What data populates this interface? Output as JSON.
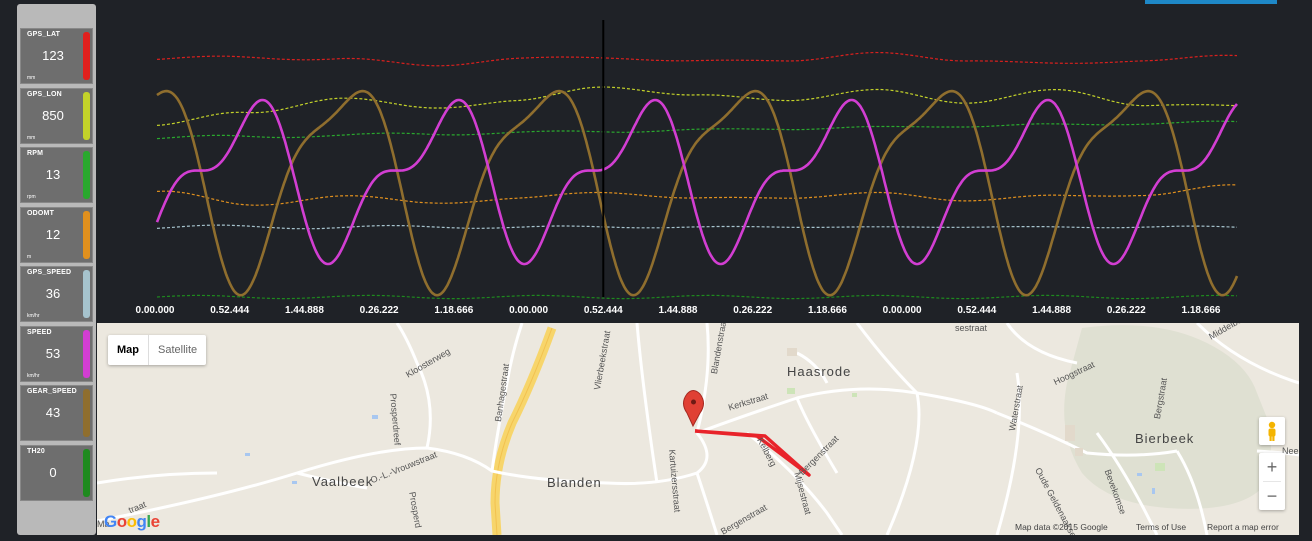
{
  "sensors": [
    {
      "name": "GPS_LAT",
      "value": "123",
      "unit": "mm",
      "color": "#e0201e"
    },
    {
      "name": "GPS_LON",
      "value": "850",
      "unit": "mm",
      "color": "#c3d22a"
    },
    {
      "name": "RPM",
      "value": "13",
      "unit": "rpm",
      "color": "#2aa82e"
    },
    {
      "name": "ODOMT",
      "value": "12",
      "unit": "m",
      "color": "#e0901e"
    },
    {
      "name": "GPS_SPEED",
      "value": "36",
      "unit": "km/hr",
      "color": "#a6c3cd"
    },
    {
      "name": "SPEED",
      "value": "53",
      "unit": "km/hr",
      "color": "#d23ed2"
    },
    {
      "name": "GEAR_SPEED",
      "value": "43",
      "unit": "",
      "color": "#8f6e2e"
    },
    {
      "name": "TH20",
      "value": "0",
      "unit": "",
      "color": "#1e8a1e"
    }
  ],
  "chart_data": {
    "type": "line",
    "x_tick_labels": [
      "0.00.000",
      "0.52.444",
      "1.44.888",
      "0.26.222",
      "1.18.666",
      "0.00.000",
      "0.52.444",
      "1.44.888",
      "0.26.222",
      "1.18.666",
      "0.00.000",
      "0.52.444",
      "1.44.888",
      "0.26.222",
      "1.18.666"
    ],
    "series": [
      {
        "name": "GPS_LAT",
        "color": "#d8201e",
        "style": "dashed",
        "values": [
          0.9,
          0.91,
          0.9,
          0.88,
          0.9,
          0.91,
          0.89,
          0.9,
          0.92,
          0.9,
          0.88,
          0.9,
          0.91
        ]
      },
      {
        "name": "GPS_LON",
        "color": "#c3d22a",
        "style": "dashed",
        "values": [
          0.65,
          0.7,
          0.75,
          0.72,
          0.74,
          0.8,
          0.76,
          0.75,
          0.78,
          0.74,
          0.78,
          0.73,
          0.72
        ]
      },
      {
        "name": "RPM",
        "color": "#2aa82e",
        "style": "dashed",
        "values": [
          0.6,
          0.61,
          0.61,
          0.62,
          0.62,
          0.63,
          0.63,
          0.64,
          0.64,
          0.65,
          0.65,
          0.66,
          0.66
        ]
      },
      {
        "name": "ODOMT",
        "color": "#e0901e",
        "style": "dashed",
        "values": [
          0.4,
          0.35,
          0.38,
          0.36,
          0.37,
          0.4,
          0.37,
          0.38,
          0.39,
          0.37,
          0.38,
          0.39,
          0.42
        ]
      },
      {
        "name": "GPS_SPEED",
        "color": "#a6c3cd",
        "style": "dashed",
        "values": [
          0.26,
          0.27,
          0.26,
          0.27,
          0.26,
          0.27,
          0.26,
          0.27,
          0.26,
          0.27,
          0.26,
          0.27,
          0.26
        ]
      },
      {
        "name": "TH20",
        "color": "#1e8a1e",
        "style": "dashed",
        "values": [
          0.0,
          0.0,
          0.0,
          0.0,
          0.0,
          0.0,
          0.0,
          0.0,
          0.0,
          0.0,
          0.0,
          0.0,
          0.0
        ]
      },
      {
        "name": "GEAR_SPEED",
        "color": "#8f6e2e",
        "style": "solid",
        "cycles": 5.5,
        "phase": 0.2
      },
      {
        "name": "SPEED",
        "color": "#d23ed2",
        "style": "solid",
        "cycles": 5.5,
        "phase": 0.0
      }
    ],
    "cursor_tick_index": 6,
    "grid": false
  },
  "map": {
    "map_type_labels": {
      "map": "Map",
      "satellite": "Satellite"
    },
    "places": {
      "haasrode": "Haasrode",
      "vaalbeek": "Vaalbeek",
      "blanden": "Blanden",
      "bierbeek": "Bierbeek"
    },
    "streets": [
      "Kloosterweg",
      "Prosperdreef",
      "Banhagestraat",
      "Vlierbeekstraat",
      "Blandenstraat",
      "Kerkstraat",
      "Kartuizersstraat",
      "Kelberg",
      "Bergenstraat",
      "Bergenstraat",
      "Mijsestraat",
      "O.-L.-Vrouwstraat",
      "Prosperd",
      "Hoogstraat",
      "Waterstraat",
      "Bergstraat",
      "Oude Geldenaakse",
      "Bevekomse",
      "Middelbosstraat",
      "sestraat",
      "traat",
      "Nee",
      "Ma"
    ],
    "zoom_in": "+",
    "zoom_out": "−",
    "logo": "Google",
    "attribution": {
      "data": "Map data ©2015 Google",
      "terms": "Terms of Use",
      "report": "Report a map error"
    }
  }
}
